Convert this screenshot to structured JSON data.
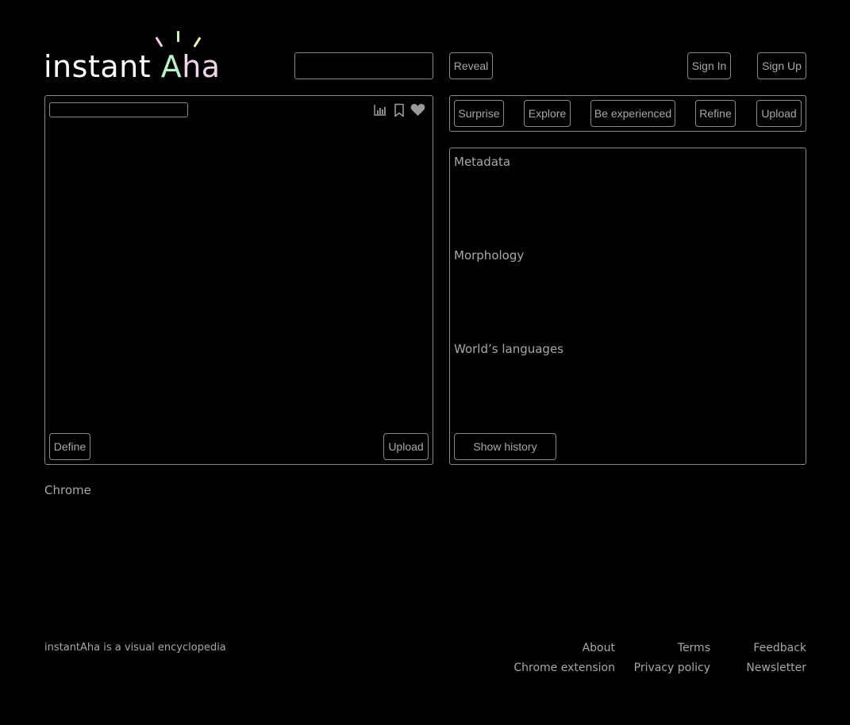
{
  "logo": {
    "text_main": "instant ",
    "text_a": "A",
    "text_ha": "ha"
  },
  "header": {
    "search": {
      "value": "",
      "placeholder": ""
    },
    "reveal_label": "Reveal",
    "sign_in_label": "Sign In",
    "sign_up_label": "Sign Up"
  },
  "left_panel": {
    "title_input": {
      "value": "",
      "placeholder": ""
    },
    "icons": [
      "stats-icon",
      "bookmark-icon",
      "heart-icon"
    ],
    "define_label": "Define",
    "upload_label": "Upload"
  },
  "actions": {
    "surprise_label": "Surprise",
    "explore_label": "Explore",
    "be_experienced_label": "Be experienced",
    "refine_label": "Refine",
    "upload_label": "Upload"
  },
  "info_panel": {
    "sections": [
      {
        "title": "Metadata"
      },
      {
        "title": "Morphology"
      },
      {
        "title": "World’s languages"
      }
    ],
    "show_history_label": "Show history"
  },
  "chrome_label": "Chrome",
  "footer": {
    "tagline": "instantAha is a visual encyclopedia",
    "links": {
      "about": "About",
      "terms": "Terms",
      "feedback": "Feedback",
      "chrome_extension": "Chrome extension",
      "privacy_policy": "Privacy policy",
      "newsletter": "Newsletter"
    }
  }
}
